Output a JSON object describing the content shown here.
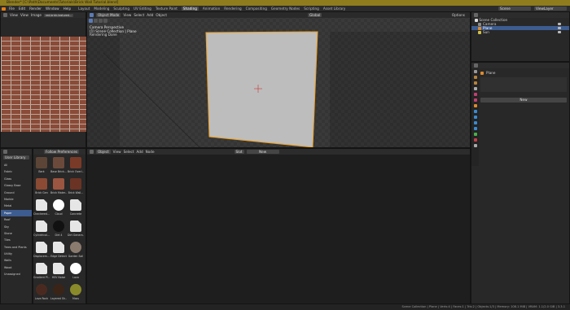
{
  "title": "Blender* [C:\\Path\\Documents\\Tutorials\\Brick Wall Tutorial.blend]",
  "menu": [
    "File",
    "Edit",
    "Render",
    "Window",
    "Help"
  ],
  "workspace_tabs": [
    "Layout",
    "Modeling",
    "Sculpting",
    "UV Editing",
    "Texture Paint",
    "Shading",
    "Animation",
    "Rendering",
    "Compositing",
    "Geometry Nodes",
    "Scripting",
    "Asset Library"
  ],
  "active_tab": "Shading",
  "scene": {
    "label": "Scene",
    "view_layer": "ViewLayer"
  },
  "image_editor": {
    "menu": [
      "View",
      "View",
      "Image"
    ],
    "image_name": "red-brick-textured..."
  },
  "viewport": {
    "mode": "Object Mode",
    "menu": [
      "View",
      "Select",
      "Add",
      "Object"
    ],
    "overlay_lines": [
      "Camera Perspective",
      "(1) Scene Collection | Plane",
      "Rendering Done"
    ],
    "orientation": "Global",
    "options": "Options"
  },
  "asset_browser": {
    "library": "User Library",
    "import": "Follow Preferences",
    "categories": [
      "All",
      "Fabric",
      "Glass",
      "Glossy Base",
      "Ground",
      "Marble",
      "Metal",
      "Paper",
      "Roof",
      "Sky",
      "Stone",
      "Tiles",
      "Trees and Plants",
      "Utility",
      "Walls",
      "Wood",
      "Unassigned"
    ],
    "selected_category": "Paper",
    "assets": [
      [
        "Bark",
        "Base Brick...",
        "Brick Overl..."
      ],
      [
        "Brick Gen",
        "Brick Mater...",
        "Brick Wall..."
      ],
      [
        "Checkered...",
        "Cloud",
        "Concrete"
      ],
      [
        "Cylindrical...",
        "Dirt 4",
        "Dirt Genera..."
      ],
      [
        "Displacem...",
        "Edge Detect",
        "Garden Soil"
      ],
      [
        "Gradient Pl...",
        "HSV Noise",
        "Lava"
      ],
      [
        "Lava Rock",
        "Layered Sh...",
        "Moss"
      ]
    ]
  },
  "node_editor": {
    "menu": [
      "Object",
      "View",
      "Select",
      "Add",
      "Node"
    ],
    "slot": "Slot",
    "material": "New"
  },
  "outliner": {
    "header": "Scene Collection",
    "items": [
      {
        "name": "Camera",
        "selected": false
      },
      {
        "name": "Plane",
        "selected": true
      },
      {
        "name": "Sun",
        "selected": false
      }
    ]
  },
  "properties": {
    "object": "Plane",
    "button": "New"
  },
  "statusbar": "Scene Collection | Plane | Verts:4 | Faces:1 | Tris:2 | Objects:1/3 | Memory: 108.1 MiB | VRAM: 1.1/2.0 GiB | 3.3.1"
}
